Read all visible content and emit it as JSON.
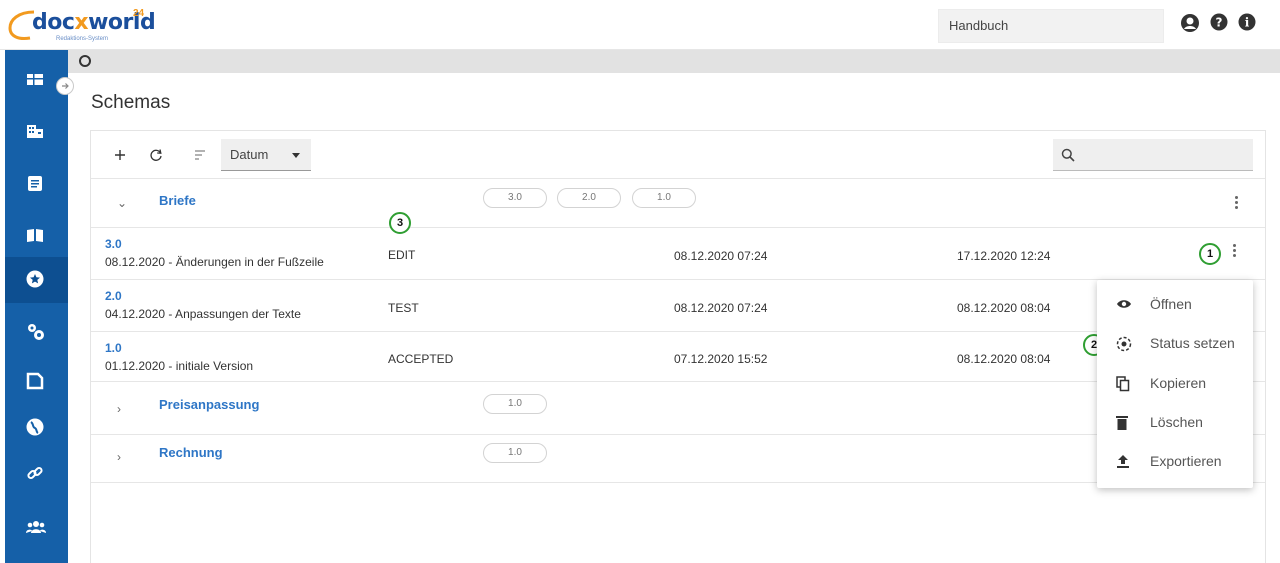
{
  "app": {
    "logo_text_a": "doc",
    "logo_text_x": "x",
    "logo_text_b": "world",
    "logo_sup": "24",
    "logo_sub": "Redaktions-System",
    "accent": "#1560a8",
    "brand_orange": "#f29a1f"
  },
  "topbar": {
    "search_value": "Handbuch",
    "icons": [
      "user-icon",
      "help-icon",
      "info-icon"
    ]
  },
  "sidebar": {
    "items": [
      {
        "icon": "dashboard-icon"
      },
      {
        "icon": "building-icon"
      },
      {
        "icon": "document-icon"
      },
      {
        "icon": "book-icon"
      },
      {
        "icon": "schema-icon",
        "active": true
      },
      {
        "icon": "settings-icon"
      },
      {
        "icon": "file-icon"
      },
      {
        "icon": "globe-icon"
      },
      {
        "icon": "link-icon"
      },
      {
        "icon": "users-icon"
      }
    ]
  },
  "page": {
    "title": "Schemas"
  },
  "toolbar": {
    "sort_value": "Datum"
  },
  "groups": [
    {
      "name": "Briefe",
      "expanded": true,
      "versions": [
        "3.0",
        "2.0",
        "1.0"
      ],
      "rows": [
        {
          "version": "3.0",
          "description": "08.12.2020 - Änderungen in der Fußzeile",
          "status": "EDIT",
          "created": "08.12.2020 07:24",
          "modified": "17.12.2020 12:24"
        },
        {
          "version": "2.0",
          "description": "04.12.2020 - Anpassungen der Texte",
          "status": "TEST",
          "created": "08.12.2020 07:24",
          "modified": "08.12.2020 08:04"
        },
        {
          "version": "1.0",
          "description": "01.12.2020 - initiale Version",
          "status": "ACCEPTED",
          "created": "07.12.2020 15:52",
          "modified": "08.12.2020 08:04"
        }
      ]
    },
    {
      "name": "Preisanpassung",
      "expanded": false,
      "versions": [
        "1.0"
      ]
    },
    {
      "name": "Rechnung",
      "expanded": false,
      "versions": [
        "1.0"
      ]
    }
  ],
  "badges": [
    "1",
    "2",
    "3"
  ],
  "context_menu": {
    "items": [
      {
        "label": "Öffnen",
        "icon": "eye-icon"
      },
      {
        "label": "Status setzen",
        "icon": "status-icon"
      },
      {
        "label": "Kopieren",
        "icon": "copy-icon"
      },
      {
        "label": "Löschen",
        "icon": "trash-icon"
      },
      {
        "label": "Exportieren",
        "icon": "export-icon"
      }
    ]
  }
}
